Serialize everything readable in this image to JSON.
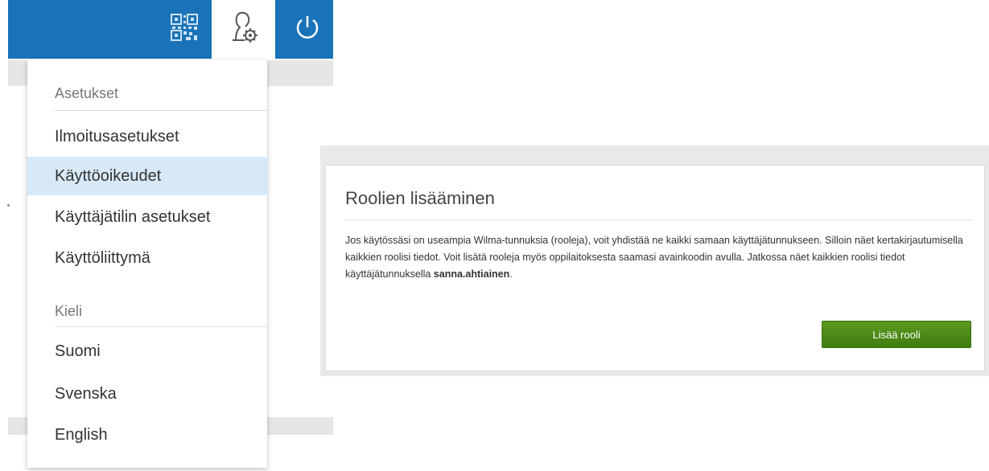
{
  "topbar": {
    "qr_icon": "qr-code-icon",
    "profile_icon": "user-settings-icon",
    "power_icon": "power-icon",
    "accent_color": "#1a73b8"
  },
  "menu": {
    "settings_heading": "Asetukset",
    "items": [
      {
        "label": "Ilmoitusasetukset"
      },
      {
        "label": "Käyttöoikeudet",
        "active": true
      },
      {
        "label": "Käyttäjätilin asetukset"
      },
      {
        "label": "Käyttöliittymä"
      }
    ],
    "language_heading": "Kieli",
    "languages": [
      {
        "label": "Suomi"
      },
      {
        "label": "Svenska"
      },
      {
        "label": "English"
      }
    ]
  },
  "card": {
    "title": "Roolien lisääminen",
    "text_main": "Jos käytössäsi on useampia Wilma-tunnuksia (rooleja), voit yhdistää ne kaikki samaan käyttäjätunnukseen. Silloin näet kertakirjautumisella kaikkien roolisi tiedot. Voit lisätä rooleja myös oppilaitoksesta saamasi avainkoodin avulla. Jatkossa näet kaikkien roolisi tiedot käyttäjätunnuksella ",
    "username": "sanna.ahtiainen",
    "text_end": ".",
    "button_label": "Lisää rooli",
    "button_color": "#4a8a16"
  }
}
